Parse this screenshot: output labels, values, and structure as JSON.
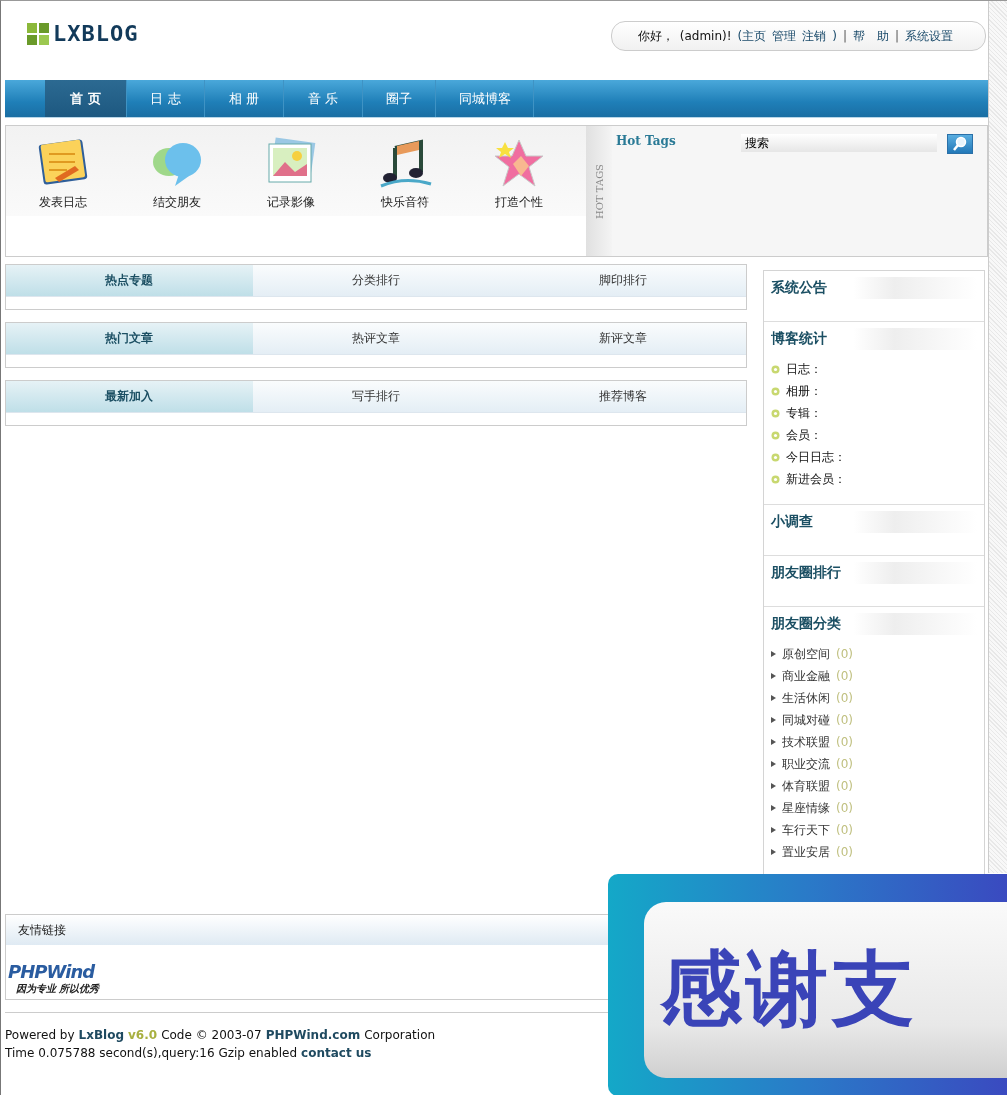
{
  "logo": {
    "text": "LXBLOG"
  },
  "user_bar": [
    {
      "text": "你好，",
      "kind": "plain"
    },
    {
      "text": "(admin)!",
      "kind": "plain"
    },
    {
      "text": "(主页",
      "kind": "link"
    },
    {
      "text": "管理",
      "kind": "link"
    },
    {
      "text": "注销",
      "kind": "link"
    },
    {
      "text": ")",
      "kind": "link"
    },
    {
      "text": "|",
      "kind": "sep"
    },
    {
      "text": "帮　助",
      "kind": "link"
    },
    {
      "text": "|",
      "kind": "sep"
    },
    {
      "text": "系统设置",
      "kind": "link"
    }
  ],
  "nav": [
    {
      "label": "首 页",
      "selected": true
    },
    {
      "label": "日 志",
      "selected": false
    },
    {
      "label": "相 册",
      "selected": false
    },
    {
      "label": "音 乐",
      "selected": false
    },
    {
      "label": "圈子",
      "selected": false
    },
    {
      "label": "同城博客",
      "selected": false
    }
  ],
  "quick_links": [
    {
      "label": "发表日志",
      "kind": "note"
    },
    {
      "label": "结交朋友",
      "kind": "chat"
    },
    {
      "label": "记录影像",
      "kind": "photo"
    },
    {
      "label": "快乐音符",
      "kind": "music"
    },
    {
      "label": "打造个性",
      "kind": "star"
    }
  ],
  "hot_tags": {
    "side_label": "HOT TAGS",
    "title": "Hot Tags",
    "search": {
      "value": "搜索"
    }
  },
  "tab_boxes": [
    {
      "tabs": [
        {
          "label": "热点专题",
          "selected": true
        },
        {
          "label": "分类排行",
          "selected": false
        },
        {
          "label": "脚印排行",
          "selected": false
        }
      ]
    },
    {
      "tabs": [
        {
          "label": "热门文章",
          "selected": true
        },
        {
          "label": "热评文章",
          "selected": false
        },
        {
          "label": "新评文章",
          "selected": false
        }
      ]
    },
    {
      "tabs": [
        {
          "label": "最新加入",
          "selected": true
        },
        {
          "label": "写手排行",
          "selected": false
        },
        {
          "label": "推荐博客",
          "selected": false
        }
      ]
    }
  ],
  "sidebar": [
    {
      "title": "系统公告"
    },
    {
      "title": "博客统计",
      "stats": [
        "日志：",
        "相册：",
        "专辑：",
        "会员：",
        "今日日志：",
        "新进会员："
      ]
    },
    {
      "title": "小调查"
    },
    {
      "title": "朋友圈排行"
    },
    {
      "title": "朋友圈分类",
      "categories": [
        {
          "name": "原创空间",
          "count": "(0)"
        },
        {
          "name": "商业金融",
          "count": "(0)"
        },
        {
          "name": "生活休闲",
          "count": "(0)"
        },
        {
          "name": "同城对碰",
          "count": "(0)"
        },
        {
          "name": "技术联盟",
          "count": "(0)"
        },
        {
          "name": "职业交流",
          "count": "(0)"
        },
        {
          "name": "体育联盟",
          "count": "(0)"
        },
        {
          "name": "星座情缘",
          "count": "(0)"
        },
        {
          "name": "车行天下",
          "count": "(0)"
        },
        {
          "name": "置业安居",
          "count": "(0)"
        }
      ]
    }
  ],
  "friend_links": {
    "title": "友情链接",
    "logo": {
      "name": "PHPWind",
      "slogan": "因为专业 所以优秀"
    }
  },
  "footer": {
    "lines": [
      [
        {
          "text": "Powered by",
          "kind": "plain"
        },
        {
          "text": "LxBlog",
          "kind": "link"
        },
        {
          "text": "v6.0",
          "kind": "version"
        },
        {
          "text": "Code © 2003-07",
          "kind": "plain"
        },
        {
          "text": "PHPWind.com",
          "kind": "link"
        },
        {
          "text": "Corporation",
          "kind": "plain"
        }
      ],
      [
        {
          "text": "Time 0.075788 second(s),query:16 Gzip enabled",
          "kind": "plain"
        },
        {
          "text": "contact us",
          "kind": "link"
        }
      ]
    ]
  },
  "overlay": {
    "text": "感谢支"
  }
}
